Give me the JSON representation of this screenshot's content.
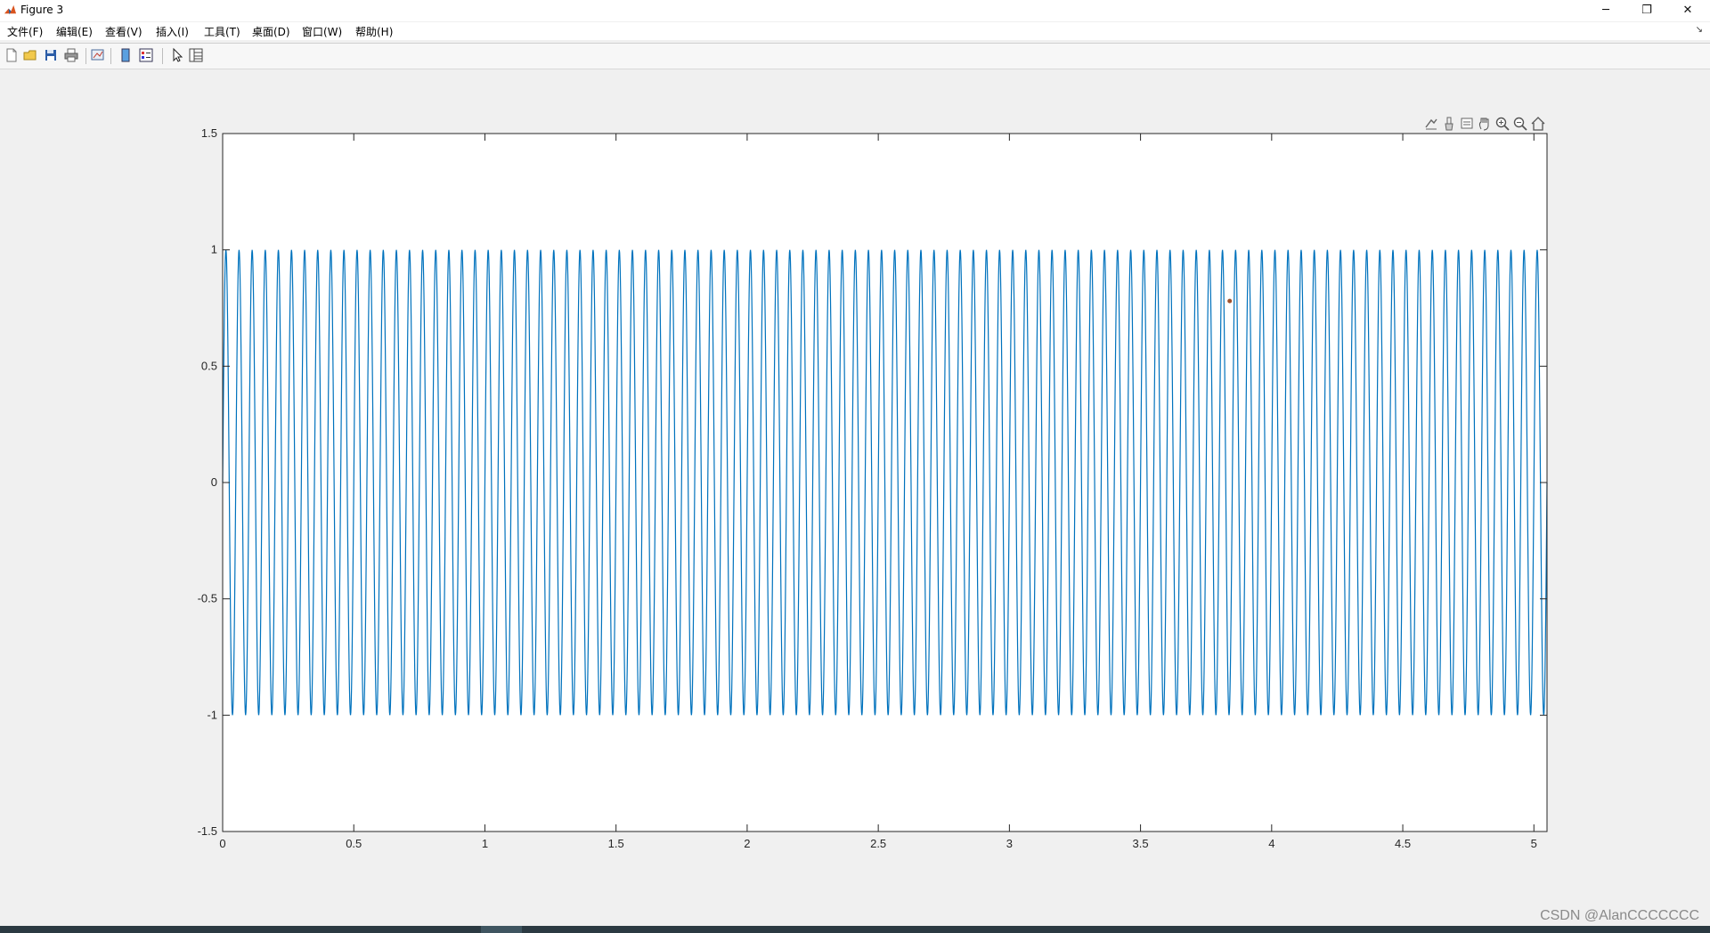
{
  "window": {
    "title": "Figure 3",
    "controls": {
      "minimize": "─",
      "restore": "❐",
      "close": "✕"
    }
  },
  "menu": {
    "items": [
      "文件(F)",
      "编辑(E)",
      "查看(V)",
      "插入(I)",
      "工具(T)",
      "桌面(D)",
      "窗口(W)",
      "帮助(H)"
    ]
  },
  "toolbar": {
    "buttons": [
      "new-figure-icon",
      "open-file-icon",
      "save-icon",
      "print-icon",
      "link-plot-icon",
      "insert-colorbar-icon",
      "insert-legend-icon",
      "edit-plot-icon",
      "property-inspector-icon"
    ]
  },
  "axes_toolbar": {
    "buttons": [
      "export-icon",
      "brush-icon",
      "data-tips-icon",
      "pan-icon",
      "zoom-in-icon",
      "zoom-out-icon",
      "home-icon"
    ]
  },
  "chart_data": {
    "type": "line",
    "title": "",
    "xlabel": "",
    "ylabel": "",
    "xlim": [
      0,
      5.05
    ],
    "ylim": [
      -1.5,
      1.5
    ],
    "xticks": [
      "0",
      "0.5",
      "1",
      "1.5",
      "2",
      "2.5",
      "3",
      "3.5",
      "4",
      "4.5",
      "5"
    ],
    "yticks": [
      "1.5",
      "1",
      "0.5",
      "0",
      "-0.5",
      "-1",
      "-1.5"
    ],
    "grid": false,
    "series": [
      {
        "function": "sin(2*pi*f*t)",
        "frequency_hz": 20,
        "amplitude": 1,
        "t_start": 0,
        "t_end": 5.05,
        "color": "#0072BD"
      }
    ],
    "data_cursor_point": {
      "x": 3.84,
      "y": 0.78
    }
  },
  "watermark": "CSDN @AlanCCCCCCC",
  "colors": {
    "line": "#0072BD",
    "axes_bg": "#ffffff",
    "figure_bg": "#f0f0f0"
  }
}
